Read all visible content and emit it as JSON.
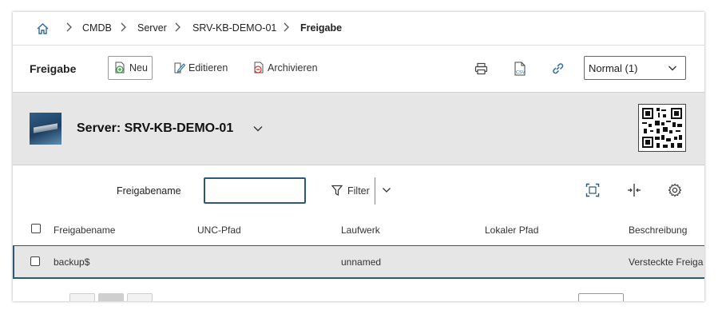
{
  "breadcrumb": {
    "items": [
      "CMDB",
      "Server",
      "SRV-KB-DEMO-01"
    ],
    "current": "Freigabe"
  },
  "toolbar": {
    "title": "Freigabe",
    "new_label": "Neu",
    "edit_label": "Editieren",
    "archive_label": "Archivieren",
    "view_select_value": "Normal (1)"
  },
  "object": {
    "title": "Server: SRV-KB-DEMO-01"
  },
  "filter": {
    "field_label": "Freigabename",
    "input_value": "",
    "filter_label": "Filter"
  },
  "table": {
    "columns": [
      "Freigabename",
      "UNC-Pfad",
      "Laufwerk",
      "Lokaler Pfad",
      "Beschreibung"
    ],
    "rows": [
      [
        "backup$",
        "",
        "unnamed",
        "",
        "Versteckte Freiga"
      ]
    ]
  },
  "icons": {
    "home": "home-icon",
    "chevron": "chevron-right-icon",
    "new": "plus-document-icon",
    "edit": "pencil-document-icon",
    "archive": "minus-document-icon",
    "print": "printer-icon",
    "csv": "csv-file-icon",
    "link": "link-icon",
    "qr": "qr-code-icon",
    "filter": "funnel-icon",
    "fit": "fit-screen-icon",
    "columns": "column-resize-icon",
    "settings": "gear-icon"
  },
  "colors": {
    "accent": "#2b5a78",
    "band_bg": "#e6e6e6",
    "icon_blue": "#2b6ca3",
    "new_green": "#2e9e3e",
    "archive_red": "#d03a2f"
  }
}
